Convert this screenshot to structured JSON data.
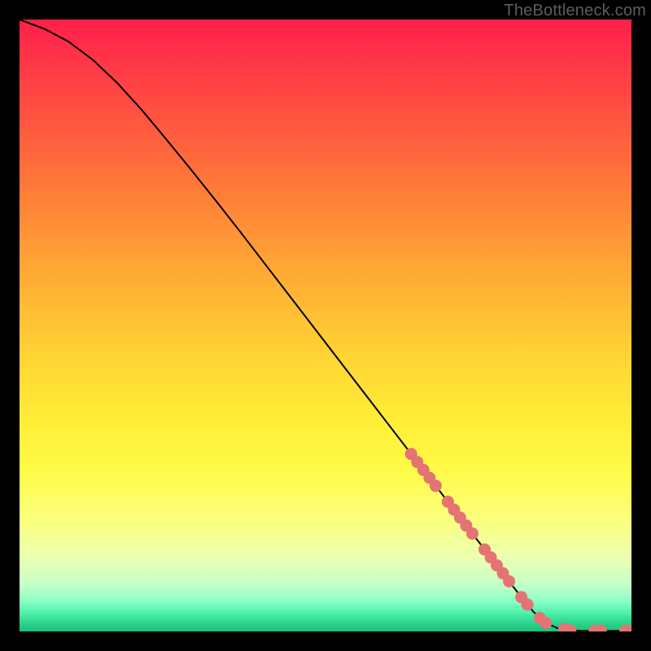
{
  "watermark": "TheBottleneck.com",
  "colors": {
    "curve": "#000000",
    "marker_fill": "#e57373",
    "marker_stroke": "#c45a5a"
  },
  "chart_data": {
    "type": "line",
    "title": "",
    "xlabel": "",
    "ylabel": "",
    "xlim": [
      0,
      100
    ],
    "ylim": [
      0,
      100
    ],
    "grid": false,
    "legend": false,
    "series": [
      {
        "name": "curve",
        "kind": "line",
        "x": [
          0,
          4,
          8,
          12,
          16,
          20,
          24,
          28,
          32,
          36,
          40,
          44,
          48,
          52,
          56,
          60,
          64,
          68,
          72,
          76,
          80,
          82,
          84,
          86,
          88,
          90,
          92,
          94,
          96,
          98,
          100
        ],
        "y": [
          100,
          98.5,
          96.4,
          93.4,
          89.6,
          85.2,
          80.4,
          75.5,
          70.5,
          65.4,
          60.2,
          55.0,
          49.8,
          44.6,
          39.4,
          34.2,
          29.0,
          23.8,
          18.6,
          13.4,
          8.2,
          5.6,
          3.2,
          1.4,
          0.5,
          0.2,
          0.1,
          0.1,
          0.1,
          0.1,
          0.1
        ]
      },
      {
        "name": "markers",
        "kind": "scatter",
        "x": [
          64,
          65,
          66,
          67,
          68,
          70,
          71,
          72,
          73,
          74,
          76,
          77,
          78,
          79,
          80,
          82,
          83,
          85,
          86,
          89,
          90,
          94,
          95,
          99,
          100
        ],
        "y": [
          29.0,
          27.7,
          26.4,
          25.1,
          23.8,
          21.2,
          19.9,
          18.6,
          17.3,
          16.0,
          13.4,
          12.1,
          10.8,
          9.5,
          8.2,
          5.6,
          4.4,
          2.2,
          1.4,
          0.35,
          0.2,
          0.1,
          0.1,
          0.1,
          0.1
        ]
      }
    ]
  }
}
